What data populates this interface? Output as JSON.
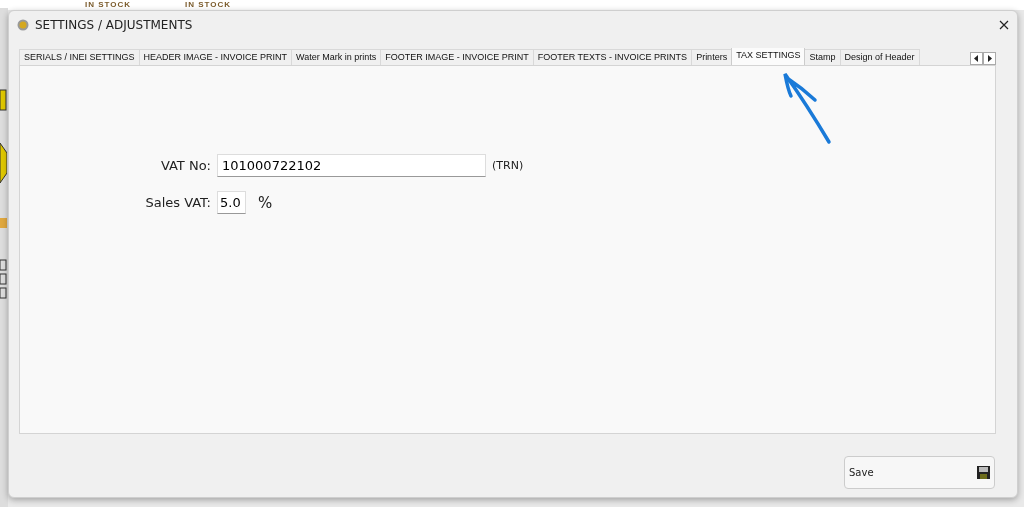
{
  "background_app": {
    "labels": [
      "IN STOCK",
      "IN STOCK"
    ]
  },
  "window": {
    "title": "SETTINGS / ADJUSTMENTS"
  },
  "tabs": [
    {
      "label": "SERIALS / INEI SETTINGS",
      "selected": false
    },
    {
      "label": "HEADER IMAGE - INVOICE PRINT",
      "selected": false
    },
    {
      "label": "Water Mark in prints",
      "selected": false
    },
    {
      "label": "FOOTER IMAGE - INVOICE PRINT",
      "selected": false
    },
    {
      "label": "FOOTER TEXTS - INVOICE PRINTS",
      "selected": false
    },
    {
      "label": "Printers",
      "selected": false
    },
    {
      "label": "TAX SETTINGS",
      "selected": true
    },
    {
      "label": "Stamp",
      "selected": false
    },
    {
      "label": "Design of Header",
      "selected": false
    }
  ],
  "form": {
    "vat_no": {
      "label": "VAT No:",
      "value": "101000722102",
      "suffix": "(TRN)"
    },
    "sales_vat": {
      "label": "Sales VAT:",
      "value": "5.0",
      "suffix": "%"
    }
  },
  "buttons": [
    {
      "label": "Save"
    }
  ]
}
